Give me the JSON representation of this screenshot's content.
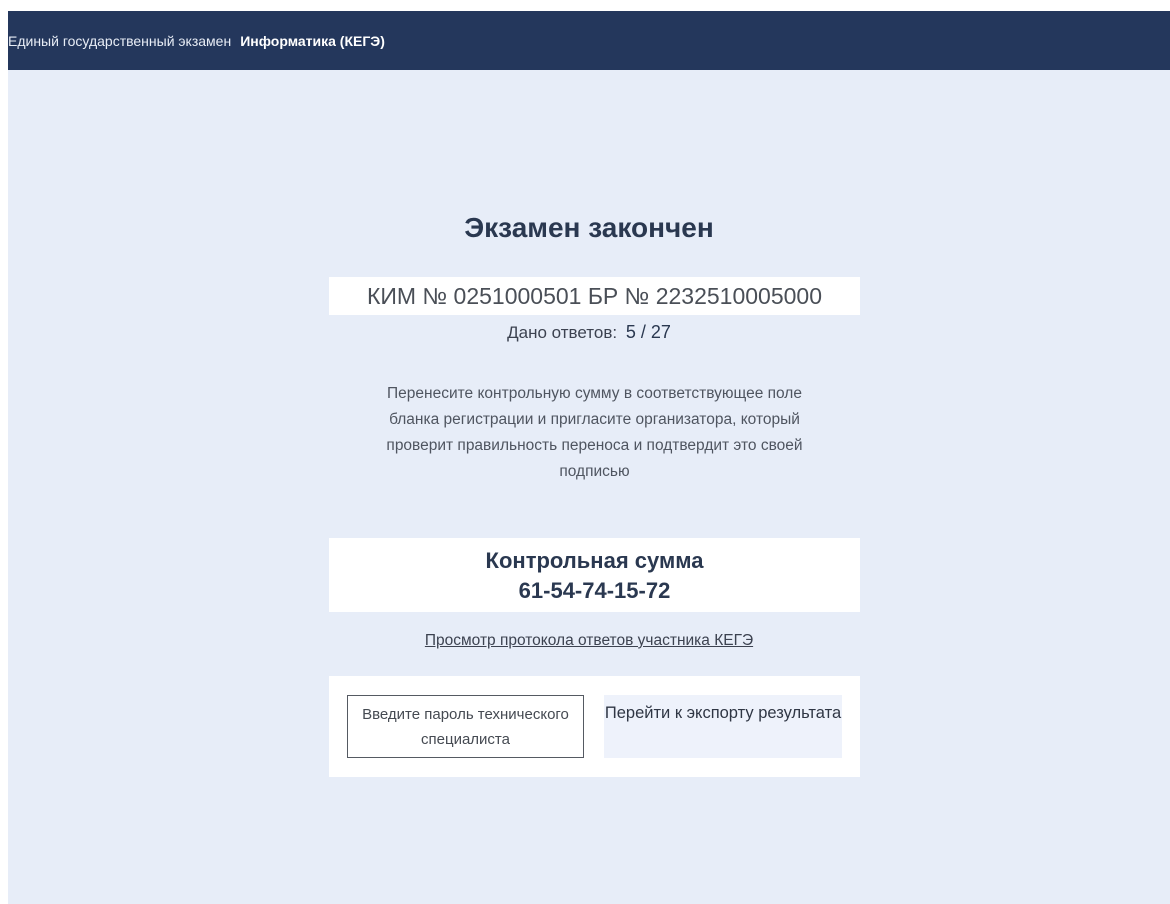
{
  "header": {
    "exam_name": "Единый государственный экзамен",
    "subject": "Информатика (КЕГЭ)"
  },
  "main": {
    "title": "Экзамен закончен",
    "kim_line": "КИМ № 0251000501  БР № 2232510005000",
    "answers_label": "Дано ответов:",
    "answers_value": "5 / 27",
    "instructions": "Перенесите контрольную сумму в соответствующее поле бланка регистрации и пригласите организатора, который проверит правильность переноса и подтвердит это своей подписью",
    "checksum_label": "Контрольная сумма",
    "checksum_value": "61-54-74-15-72",
    "protocol_link": "Просмотр протокола ответов участника КЕГЭ"
  },
  "actions": {
    "password_placeholder": "Введите пароль технического специалиста",
    "export_label": "Перейти к экспорту результата"
  },
  "colors": {
    "header_bg": "#24375c",
    "page_bg": "#e7edf8",
    "text_dark": "#2a3850"
  }
}
